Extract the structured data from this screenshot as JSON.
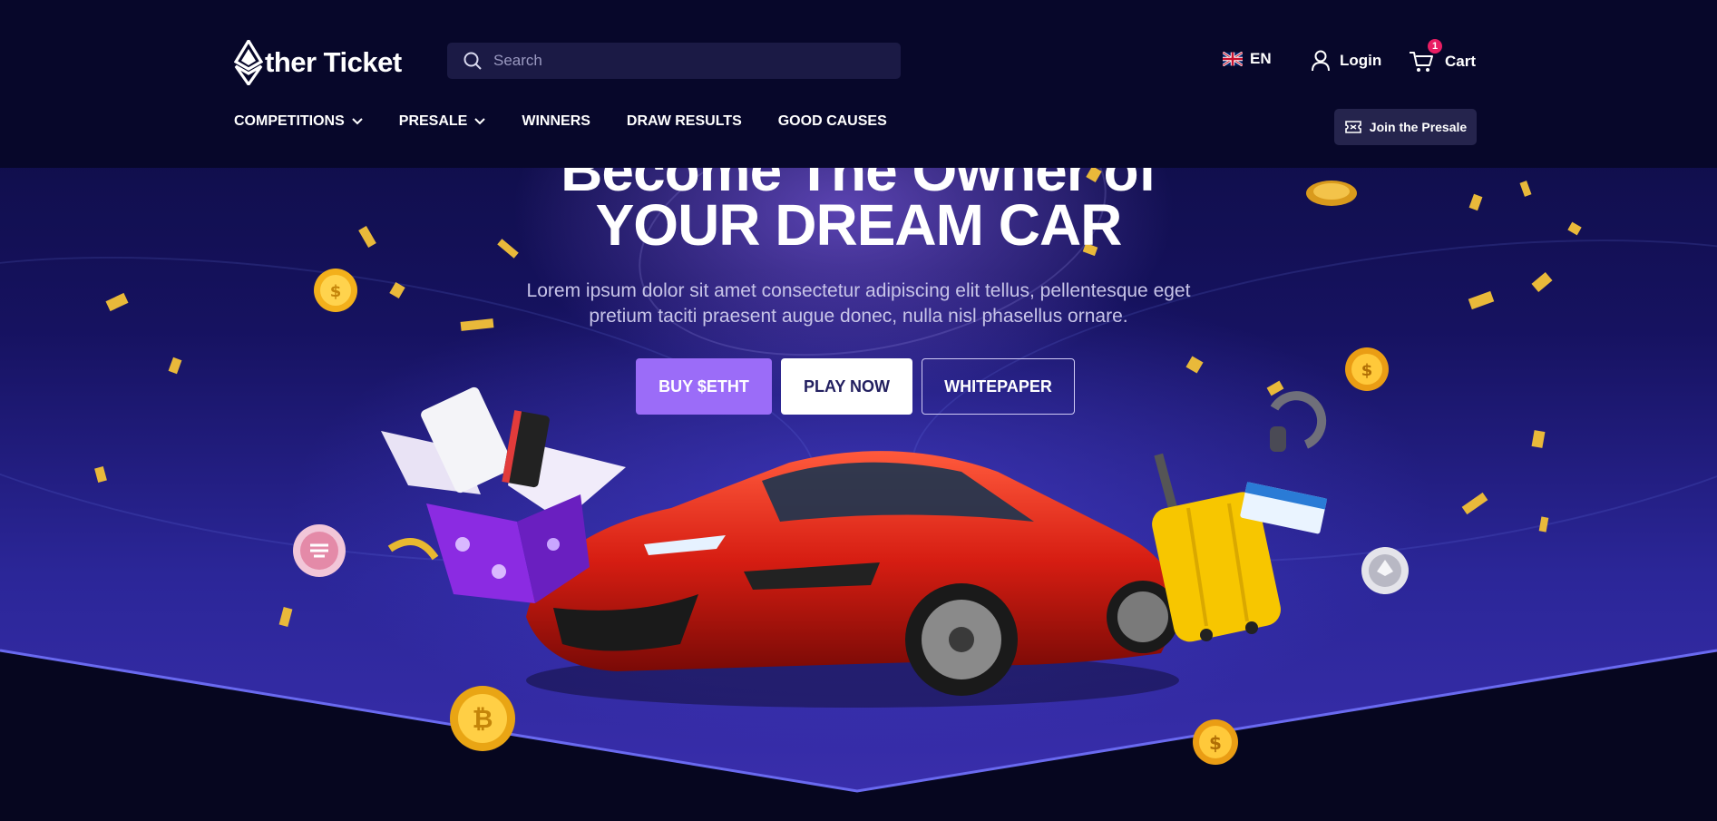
{
  "header": {
    "logo_text": "ther Ticket",
    "search_placeholder": "Search",
    "language": "EN",
    "login_label": "Login",
    "cart_label": "Cart",
    "cart_count": "1",
    "nav": [
      {
        "label": "COMPETITIONS",
        "has_dropdown": true
      },
      {
        "label": "PRESALE",
        "has_dropdown": true
      },
      {
        "label": "WINNERS",
        "has_dropdown": false
      },
      {
        "label": "DRAW RESULTS",
        "has_dropdown": false
      },
      {
        "label": "GOOD CAUSES",
        "has_dropdown": false
      }
    ],
    "join_presale_label": "Join the Presale"
  },
  "hero": {
    "title_line1": "Become The Owner of",
    "title_line2": "YOUR DREAM CAR",
    "subtitle": "Lorem ipsum dolor sit amet consectetur adipiscing elit tellus, pellentesque eget pretium taciti praesent augue donec, nulla nisl phasellus ornare.",
    "buttons": {
      "buy": "BUY $ETHT",
      "play": "PLAY NOW",
      "whitepaper": "WHITEPAPER"
    }
  },
  "icons": [
    "ether-logo-icon",
    "search-icon",
    "uk-flag-icon",
    "user-icon",
    "cart-icon",
    "chevron-down-icon",
    "ticket-icon"
  ],
  "colors": {
    "header_bg": "#07072a",
    "search_bg": "#1b1a45",
    "accent_purple": "#9b6cf8",
    "badge_red": "#e91e63",
    "page_bg": "#06061f"
  }
}
